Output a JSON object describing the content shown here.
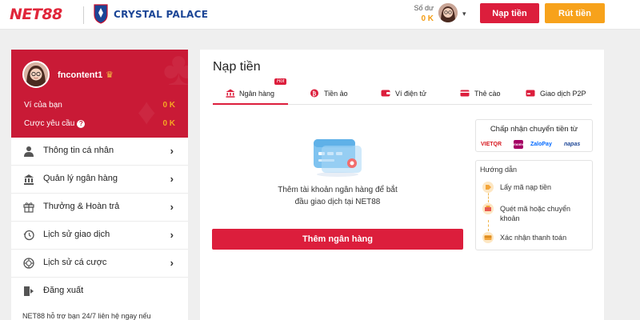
{
  "header": {
    "logo_text": "NET88",
    "partner_name": "CRYSTAL PALACE",
    "balance_label": "Số dư",
    "balance_value": "0 K",
    "deposit_button": "Nạp tiền",
    "withdraw_button": "Rút tiền"
  },
  "sidebar": {
    "username": "fncontent1",
    "wallet_label": "Ví của bạn",
    "wallet_value": "0 K",
    "bet_requirement_label": "Cược yêu cầu",
    "bet_requirement_value": "0 K",
    "menu": [
      {
        "label": "Thông tin cá nhân",
        "icon": "user-icon"
      },
      {
        "label": "Quản lý ngân hàng",
        "icon": "bank-icon"
      },
      {
        "label": "Thưởng & Hoàn trả",
        "icon": "gift-icon"
      },
      {
        "label": "Lịch sử giao dịch",
        "icon": "history-icon"
      },
      {
        "label": "Lịch sử cá cược",
        "icon": "chip-icon"
      },
      {
        "label": "Đăng xuất",
        "icon": "logout-icon"
      }
    ],
    "support_text": "NET88 hỗ trợ bạn 24/7 liên hệ ngay nếu"
  },
  "main": {
    "title": "Nạp tiền",
    "tabs": [
      {
        "label": "Ngân hàng",
        "icon": "bank-icon",
        "active": true,
        "badge": "Hot"
      },
      {
        "label": "Tiền ảo",
        "icon": "crypto-icon",
        "active": false
      },
      {
        "label": "Ví điện tử",
        "icon": "ewallet-icon",
        "active": false
      },
      {
        "label": "Thẻ cào",
        "icon": "card-icon",
        "active": false
      },
      {
        "label": "Giao dịch P2P",
        "icon": "p2p-icon",
        "active": false
      }
    ],
    "empty_message_line1": "Thêm tài khoản ngân hàng để bắt",
    "empty_message_line2": "đầu giao dịch tại NET88",
    "add_bank_button": "Thêm ngân hàng",
    "accept_title": "Chấp nhận chuyển tiền từ",
    "payment_logos": [
      "VIETQR",
      "momo",
      "ZaloPay",
      "napas"
    ],
    "guide_title": "Hướng dẫn",
    "guide_steps": [
      "Lấy mã nạp tiền",
      "Quét mã hoặc chuyển khoản",
      "Xác nhận thanh toán"
    ]
  },
  "colors": {
    "brand_red": "#dc1e3c",
    "profile_red": "#c91a36",
    "accent_orange": "#f7a21b",
    "balance_gold": "#f39c12",
    "partner_blue": "#1b4596"
  }
}
